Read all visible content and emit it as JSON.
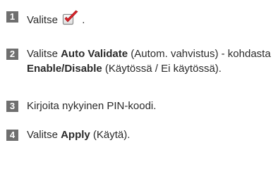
{
  "steps": [
    {
      "number": "1",
      "parts": [
        "Valitse",
        "."
      ],
      "icon": "validate-checkbox-icon"
    },
    {
      "number": "2",
      "parts": [
        "Valitse ",
        "Auto Validate",
        " (Autom. vahvistus) - kohdasta ",
        "Enable/Disable",
        " (Käytössä / Ei käytössä)."
      ]
    },
    {
      "number": "3",
      "parts": [
        "Kirjoita nykyinen PIN-koodi."
      ]
    },
    {
      "number": "4",
      "parts": [
        "Valitse ",
        "Apply",
        " (Käytä)."
      ]
    }
  ],
  "colors": {
    "badge_bg": "#6f6f6f",
    "icon_check": "#d8232a"
  }
}
